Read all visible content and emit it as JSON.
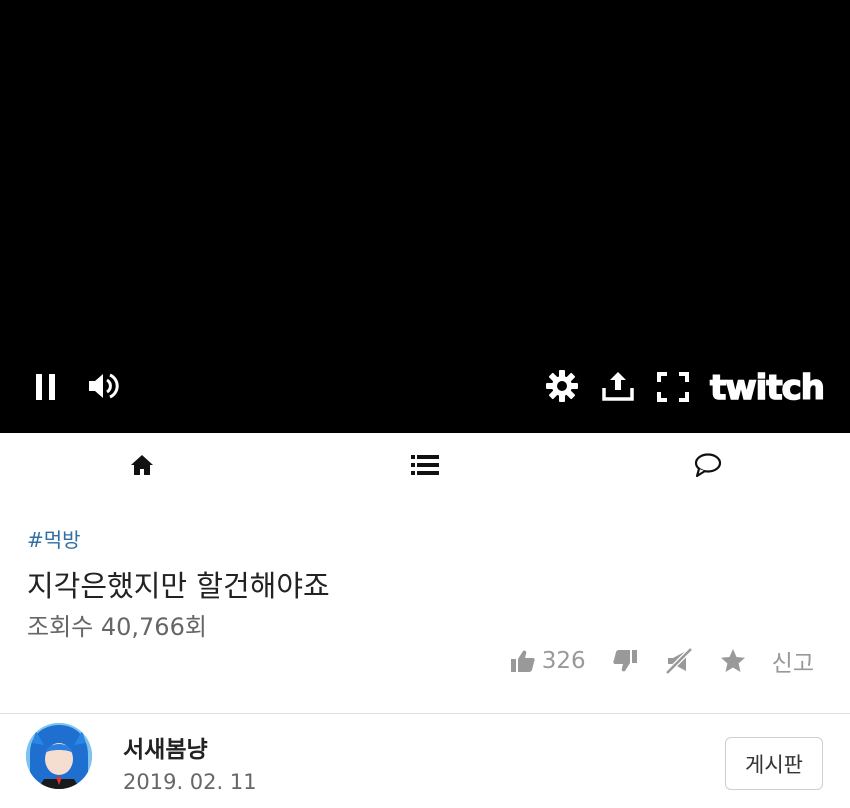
{
  "player": {
    "brand": "twitch",
    "icons": [
      "pause-icon",
      "volume-icon",
      "settings-icon",
      "share-icon",
      "fullscreen-icon"
    ]
  },
  "tabs": [
    {
      "icon": "home-icon"
    },
    {
      "icon": "list-icon"
    },
    {
      "icon": "comment-icon"
    }
  ],
  "post": {
    "hashtag": "#먹방",
    "title": "지각은했지만 할건해야죠",
    "views": "조회수 40,766회",
    "likes": "326",
    "report": "신고"
  },
  "author": {
    "name": "서새봄냥",
    "date": "2019. 02. 11"
  },
  "board_button": "게시판",
  "colors": {
    "hashtag": "#2f6fa6",
    "player_bg": "#000000",
    "muted_icon": "#999999"
  }
}
